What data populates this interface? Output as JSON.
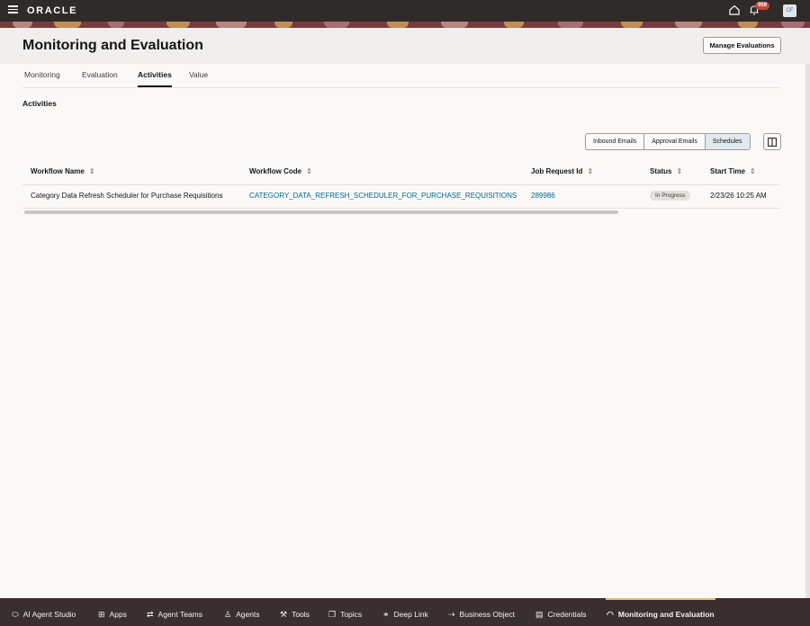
{
  "topbar": {
    "logo": "ORACLE",
    "notifications_count": "959",
    "avatar_initials": "CF"
  },
  "header": {
    "title": "Monitoring and Evaluation",
    "manage_button": "Manage Evaluations"
  },
  "tabs": [
    {
      "label": "Monitoring"
    },
    {
      "label": "Evaluation"
    },
    {
      "label": "Activities",
      "active": true
    },
    {
      "label": "Value"
    }
  ],
  "section": {
    "title": "Activities"
  },
  "toolbar": {
    "segments": [
      "Inbound Emails",
      "Approval Emails",
      "Schedules"
    ],
    "selected": "Schedules"
  },
  "table": {
    "columns": [
      "Workflow Name",
      "Workflow Code",
      "Job Request Id",
      "Status",
      "Start Time"
    ],
    "rows": [
      {
        "workflow_name": "Category Data Refresh Scheduler for Purchase Requisitions",
        "workflow_code": "CATEGORY_DATA_REFRESH_SCHEDULER_FOR_PURCHASE_REQUISITIONS",
        "job_request_id": "289986",
        "status": "In Progress",
        "start_time": "2/23/26 10:25 AM"
      }
    ]
  },
  "dock": {
    "items": [
      {
        "label": "AI Agent Studio",
        "icon": "studio-icon"
      },
      {
        "label": "Apps",
        "icon": "apps-icon"
      },
      {
        "label": "Agent Teams",
        "icon": "agent-teams-icon"
      },
      {
        "label": "Agents",
        "icon": "agents-icon"
      },
      {
        "label": "Tools",
        "icon": "tools-icon"
      },
      {
        "label": "Topics",
        "icon": "topics-icon"
      },
      {
        "label": "Deep Link",
        "icon": "link-icon"
      },
      {
        "label": "Business Object",
        "icon": "business-object-icon"
      },
      {
        "label": "Credentials",
        "icon": "credentials-icon"
      },
      {
        "label": "Monitoring and Evaluation",
        "icon": "monitoring-icon",
        "active": true
      }
    ]
  },
  "colors": {
    "topbar": "#2f2b28",
    "banner": "#7a3b3e",
    "link": "#00688c",
    "dock": "#3a2f30",
    "selected_segment": "#dfe9f2",
    "badge": "#c74634"
  }
}
